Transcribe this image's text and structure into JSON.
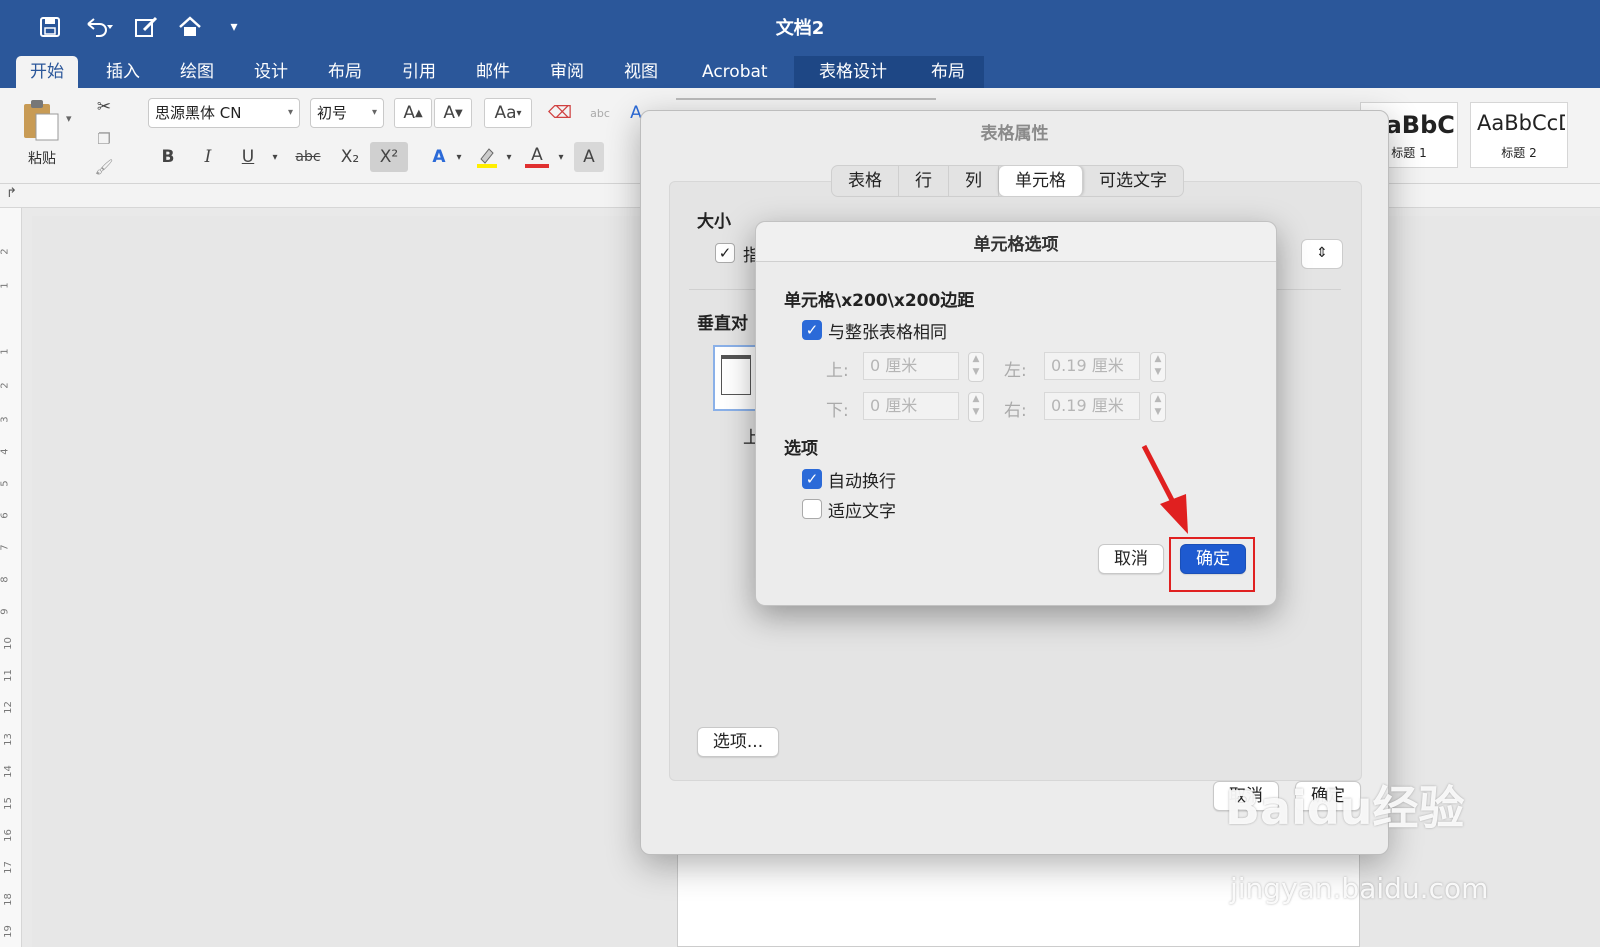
{
  "window": {
    "title": "文档2"
  },
  "tabs": [
    {
      "label": "开始",
      "active": true
    },
    {
      "label": "插入"
    },
    {
      "label": "绘图"
    },
    {
      "label": "设计"
    },
    {
      "label": "布局"
    },
    {
      "label": "引用"
    },
    {
      "label": "邮件"
    },
    {
      "label": "审阅"
    },
    {
      "label": "视图"
    },
    {
      "label": "Acrobat"
    },
    {
      "label": "表格设计",
      "contextual": true
    },
    {
      "label": "布局",
      "contextual": true
    }
  ],
  "ribbon": {
    "paste_label": "粘贴",
    "font_name": "思源黑体 CN",
    "font_size": "初号",
    "grow": "A",
    "shrink": "A",
    "change_case": "Aa",
    "bold": "B",
    "italic": "I",
    "underline": "U",
    "strike": "abc",
    "subscript": "X₂",
    "superscript": "X²",
    "text_effect": "A",
    "font_color": "A",
    "char_shade": "A",
    "styles": [
      {
        "sample": "AaBbC",
        "caption": "标题 1"
      },
      {
        "sample": "AaBbCcD",
        "caption": "标题 2"
      }
    ]
  },
  "ruler_ticks": [
    "2",
    "1",
    "1",
    "2",
    "3",
    "4",
    "5",
    "6",
    "7",
    "8",
    "9",
    "10",
    "11",
    "12",
    "13",
    "14",
    "15",
    "16",
    "17",
    "18",
    "19"
  ],
  "table_props": {
    "title": "表格属性",
    "tabs": [
      "表格",
      "行",
      "列",
      "单元格",
      "可选文字"
    ],
    "selected_tab": "单元格",
    "size_label": "大小",
    "size_check_text": "指",
    "valign_label": "垂直对",
    "valign_option": "上",
    "options_button": "选项...",
    "cancel": "取消",
    "ok": "确定"
  },
  "cell_options": {
    "title": "单元格选项",
    "margins_heading": "单元格\\x200\\x200边距",
    "same_as_table": "与整张表格相同",
    "top_label": "上:",
    "top_value": "0 厘米",
    "bottom_label": "下:",
    "bottom_value": "0 厘米",
    "left_label": "左:",
    "left_value": "0.19 厘米",
    "right_label": "右:",
    "right_value": "0.19 厘米",
    "options_heading": "选项",
    "wrap_text": "自动换行",
    "fit_text": "适应文字",
    "cancel": "取消",
    "ok": "确定"
  },
  "colors": {
    "brand": "#2b579a",
    "primary_button": "#1e5ad0",
    "highlight": "#e02020"
  },
  "watermark": {
    "main": "Baidu经验",
    "sub": "jingyan.baidu.com"
  }
}
